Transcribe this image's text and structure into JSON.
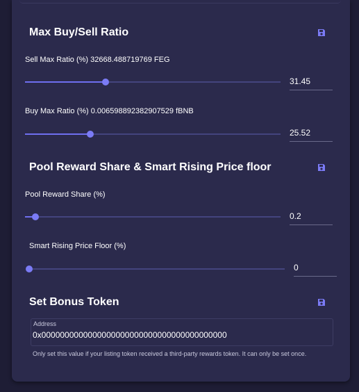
{
  "colors": {
    "background": "#1e1d35",
    "panel": "#2b2a4c",
    "accent": "#7b7bf5",
    "text": "#ffffff",
    "muted_text": "#c9c9dd"
  },
  "sections": {
    "ratio": {
      "title": "Max Buy/Sell Ratio",
      "save_icon": "floppy-disk-icon",
      "sell_label": "Sell Max Ratio (%) 32668.488719769 FEG",
      "sell_value": "31.45",
      "sell_slider_fraction": 0.3145,
      "buy_label": "Buy Max Ratio (%) 0.006598892382907529 fBNB",
      "buy_value": "25.52",
      "buy_slider_fraction": 0.2552
    },
    "pool": {
      "title": "Pool Reward Share & Smart Rising Price floor",
      "save_icon": "floppy-disk-icon",
      "share_label": "Pool Reward Share (%)",
      "share_value": "0.2",
      "share_slider_fraction": 0.04,
      "floor_label": "Smart Rising Price Floor (%)",
      "floor_value": "0",
      "floor_slider_fraction": 0.0
    },
    "bonus": {
      "title": "Set Bonus Token",
      "save_icon": "floppy-disk-icon",
      "address_label": "Address",
      "address_value": "0x0000000000000000000000000000000000000000",
      "helper": "Only set this value if your listing token received a third-party rewards token. It can only be set once."
    }
  }
}
